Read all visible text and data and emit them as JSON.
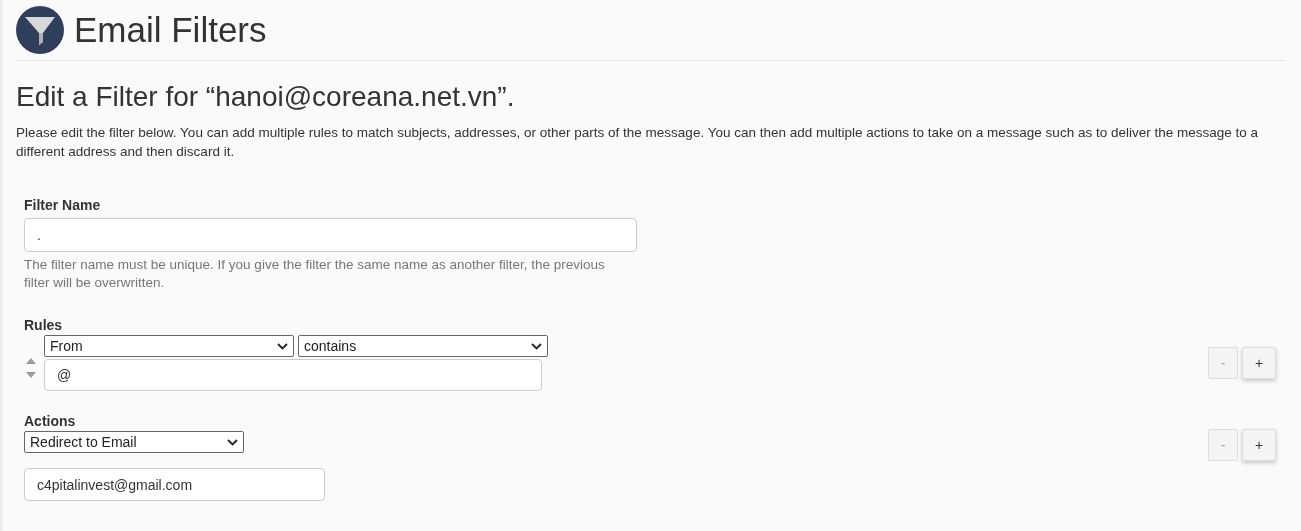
{
  "header": {
    "title": "Email Filters"
  },
  "heading": "Edit a Filter for “hanoi@coreana.net.vn”.",
  "description": "Please edit the filter below. You can add multiple rules to match subjects, addresses, or other parts of the message. You can then add multiple actions to take on a message such as to deliver the message to a different address and then discard it.",
  "filter_name": {
    "label": "Filter Name",
    "value": ".",
    "help": "The filter name must be unique. If you give the filter the same name as another filter, the previous filter will be overwritten."
  },
  "rules": {
    "label": "Rules",
    "items": [
      {
        "part": "From",
        "match": "contains",
        "value": "@",
        "remove_disabled": true
      }
    ]
  },
  "actions": {
    "label": "Actions",
    "items": [
      {
        "action": "Redirect to Email",
        "value": "c4pitalinvest@gmail.com",
        "remove_disabled": true
      }
    ]
  },
  "buttons": {
    "remove": "-",
    "add": "+"
  }
}
